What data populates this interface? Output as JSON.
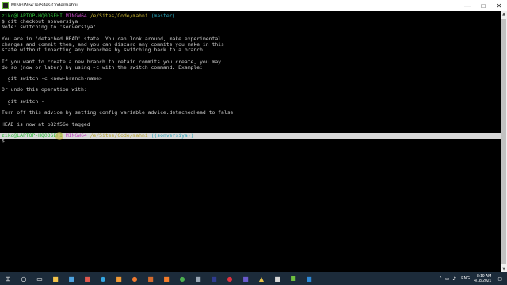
{
  "window": {
    "title": "MINGW64:/e/Sites/Code/mahni",
    "buttons": {
      "minimize": "—",
      "maximize": "□",
      "close": "✕"
    }
  },
  "terminal": {
    "prompt1": {
      "user": "ziko",
      "host": "LAPTOP-HQ0DSEHI",
      "shell": "MINGW64",
      "path": "/e/Sites/Code/mahni",
      "branch": "(master)"
    },
    "lines": [
      "$ git checkout sonversiya",
      "Note: switching to 'sonversiya'.",
      "",
      "You are in 'detached HEAD' state. You can look around, make experimental",
      "changes and commit them, and you can discard any commits you make in this",
      "state without impacting any branches by switching back to a branch.",
      "",
      "If you want to create a new branch to retain commits you create, you may",
      "do so (now or later) by using -c with the switch command. Example:",
      "",
      "  git switch -c <new-branch-name>",
      "",
      "Or undo this operation with:",
      "",
      "  git switch -",
      "",
      "Turn off this advice by setting config variable advice.detachedHead to false",
      "",
      "HEAD is now at b82f56e tagged"
    ],
    "prompt2": {
      "user": "ziko",
      "host": "LAPTOP-HQ0DSEHI",
      "shell": "MINGW64",
      "path": "/e/Sites/Code/mahni",
      "branch": "((sonversiya))"
    },
    "final_prompt": "$"
  },
  "taskbar": {
    "icons": [
      "windows-start-icon",
      "search-icon",
      "task-view-icon",
      "file-explorer-icon",
      "store-icon",
      "media-icon",
      "edge-icon",
      "sublime-icon",
      "firefox-icon",
      "photoshop-icon",
      "xampp-icon",
      "chrome-icon",
      "obs-icon",
      "app-icon",
      "opera-icon",
      "app2-icon",
      "app3-icon",
      "app4-icon",
      "terminal-icon",
      "vscode-icon"
    ],
    "lang": "ENG",
    "time": "8:19 AM",
    "date": "4/18/2021"
  },
  "colors": {
    "user_host": "#2fbf3a",
    "shell": "#c249c2",
    "path": "#c8b433",
    "branch": "#2aa4b8",
    "taskbar": "#1c2b3a"
  }
}
